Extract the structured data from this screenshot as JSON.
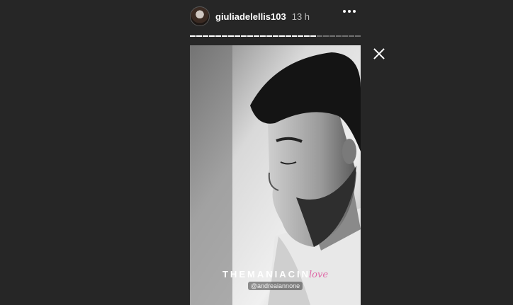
{
  "header": {
    "username": "giuliadelellis103",
    "timestamp": "13 h",
    "more_icon": "more-horizontal-icon"
  },
  "progress": {
    "segments": 27,
    "completed": 20
  },
  "close_icon": "close-icon",
  "story": {
    "overlay_title_main": "THEMANIACIN",
    "overlay_title_script": "love",
    "mention": "@andreaiannone"
  },
  "colors": {
    "background": "#262626",
    "accent_pink": "#e06aa8"
  }
}
